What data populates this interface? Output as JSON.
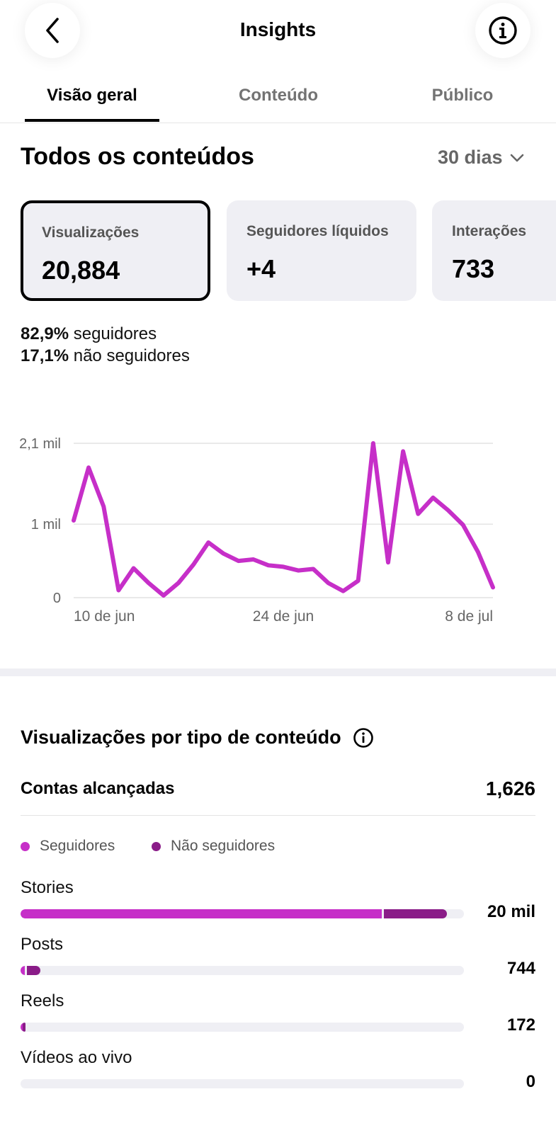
{
  "header": {
    "title": "Insights",
    "back_icon": "chevron-left-icon",
    "info_icon": "info-icon"
  },
  "tabs": [
    {
      "label": "Visão geral",
      "active": true
    },
    {
      "label": "Conteúdo",
      "active": false
    },
    {
      "label": "Público",
      "active": false
    }
  ],
  "section": {
    "title": "Todos os conteúdos",
    "period": "30 dias"
  },
  "cards": [
    {
      "label": "Visualizações",
      "value": "20,884",
      "selected": true
    },
    {
      "label": "Seguidores líquidos",
      "value": "+4",
      "selected": false
    },
    {
      "label": "Interações",
      "value": "733",
      "selected": false
    }
  ],
  "breakdown": {
    "followers_pct": "82,9%",
    "followers_text": "seguidores",
    "nonfollowers_pct": "17,1%",
    "nonfollowers_text": "não seguidores"
  },
  "chart_data": {
    "type": "line",
    "color": "#c62fc8",
    "ytick_labels": [
      "0",
      "1 mil",
      "2,1 mil"
    ],
    "ytick_values": [
      0,
      1000,
      2100
    ],
    "xtick_labels": [
      "10 de jun",
      "24 de jun",
      "8 de jul"
    ],
    "xtick_index": [
      0,
      14,
      28
    ],
    "ylim": [
      0,
      2100
    ],
    "grid": true,
    "values": [
      1050,
      1770,
      1240,
      100,
      400,
      200,
      30,
      200,
      450,
      750,
      600,
      500,
      520,
      440,
      420,
      370,
      390,
      200,
      90,
      230,
      2100,
      480,
      1990,
      1140,
      1360,
      1190,
      990,
      620,
      140
    ]
  },
  "content_types": {
    "title": "Visualizações por tipo de conteúdo",
    "info_icon": "info-icon",
    "reached_label": "Contas alcançadas",
    "reached_value": "1,626",
    "legend": [
      {
        "label": "Seguidores",
        "color": "#c62fc8"
      },
      {
        "label": "Não seguidores",
        "color": "#8a1c88"
      }
    ],
    "rows": [
      {
        "label": "Stories",
        "value": "20 mil",
        "followers_fraction": 0.814,
        "nonfollowers_fraction": 0.142
      },
      {
        "label": "Posts",
        "value": "744",
        "followers_fraction": 0.01,
        "nonfollowers_fraction": 0.03
      },
      {
        "label": "Reels",
        "value": "172",
        "followers_fraction": 0.004,
        "nonfollowers_fraction": 0.007
      },
      {
        "label": "Vídeos ao vivo",
        "value": "0",
        "followers_fraction": 0,
        "nonfollowers_fraction": 0
      }
    ]
  }
}
